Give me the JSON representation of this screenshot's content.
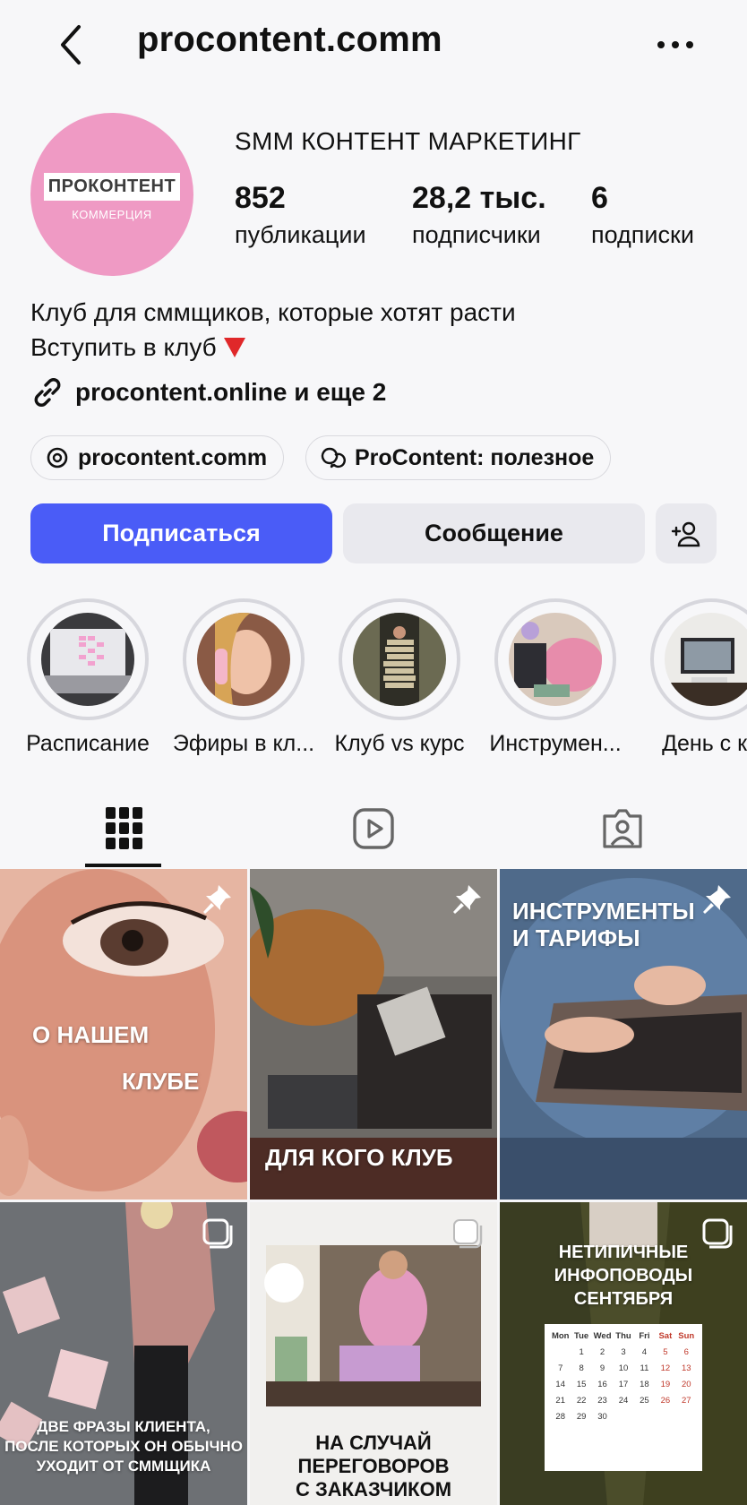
{
  "header": {
    "title": "procontent.comm"
  },
  "profile": {
    "avatar_title": "ПРОКОНТЕНТ",
    "avatar_subtitle": "КОММЕРЦИЯ",
    "name": "SMM КОНТЕНТ МАРКЕТИНГ",
    "stats": [
      {
        "value": "852",
        "label": "публикации"
      },
      {
        "value": "28,2 тыс.",
        "label": "подписчики"
      },
      {
        "value": "6",
        "label": "подписки"
      }
    ],
    "bio_line1": "Клуб для сммщиков, которые хотят расти",
    "bio_line2": "Вступить в клуб",
    "link": "procontent.online и еще 2",
    "pills": [
      "procontent.comm",
      "ProContent: полезное"
    ]
  },
  "actions": {
    "follow": "Подписаться",
    "message": "Сообщение"
  },
  "highlights": [
    {
      "label": "Расписание"
    },
    {
      "label": "Эфиры в кл..."
    },
    {
      "label": "Клуб vs курс"
    },
    {
      "label": "Инструмен..."
    },
    {
      "label": "День с кл"
    }
  ],
  "posts": [
    {
      "text1": "О НАШЕМ",
      "text2": "КЛУБЕ",
      "badge": "pin"
    },
    {
      "text1": "ДЛЯ КОГО КЛУБ",
      "badge": "pin"
    },
    {
      "text1": "ИНСТРУМЕНТЫ",
      "text2": "И ТАРИФЫ",
      "badge": "pin"
    },
    {
      "text1": "ДВЕ ФРАЗЫ КЛИЕНТА,",
      "text2": "ПОСЛЕ КОТОРЫХ ОН ОБЫЧНО",
      "text3": "УХОДИТ ОТ СММЩИКА",
      "badge": "carousel"
    },
    {
      "text1": "НА СЛУЧАЙ",
      "text2": "ПЕРЕГОВОРОВ",
      "text3": "С ЗАКАЗЧИКОМ",
      "badge": "carousel"
    },
    {
      "text1": "НЕТИПИЧНЫЕ",
      "text2": "ИНФОПОВОДЫ",
      "text3": "СЕНТЯБРЯ",
      "badge": "carousel",
      "calendar": {
        "days": [
          "Mon",
          "Tue",
          "Wed",
          "Thu",
          "Fri",
          "Sat",
          "Sun"
        ],
        "rows": [
          [
            "",
            "1",
            "2",
            "3",
            "4",
            "5",
            "6"
          ],
          [
            "7",
            "8",
            "9",
            "10",
            "11",
            "12",
            "13"
          ],
          [
            "14",
            "15",
            "16",
            "17",
            "18",
            "19",
            "20"
          ],
          [
            "21",
            "22",
            "23",
            "24",
            "25",
            "26",
            "27"
          ],
          [
            "28",
            "29",
            "30",
            "",
            "",
            "",
            ""
          ]
        ]
      }
    }
  ],
  "colors": {
    "accent": "#4a5cf7",
    "avatar_bg": "#ef9ac4",
    "weekend": "#c0392b"
  }
}
